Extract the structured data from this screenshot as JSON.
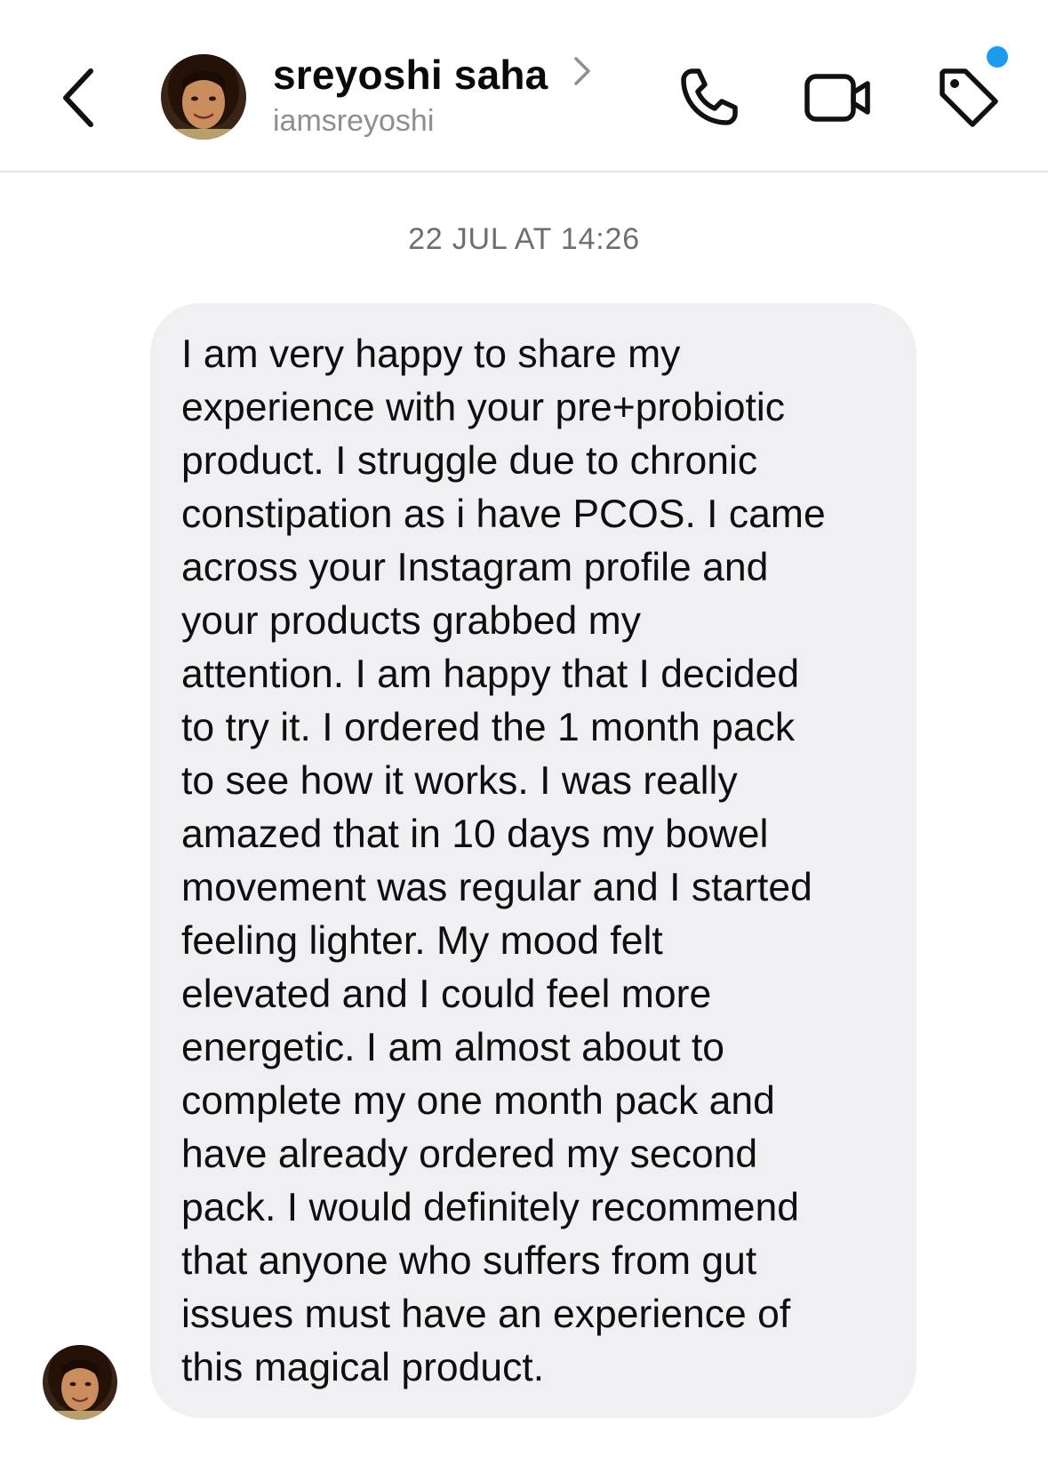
{
  "header": {
    "back_icon": "chevron-left-icon",
    "display_name": "sreyoshi saha",
    "username": "iamsreyoshi",
    "profile_chevron_icon": "chevron-right-icon",
    "actions": [
      {
        "name": "phone-icon"
      },
      {
        "name": "video-camera-icon"
      },
      {
        "name": "tag-icon"
      }
    ],
    "notification_dot_color": "#1d9bf0"
  },
  "conversation": {
    "timestamp": "22 JUL AT 14:26",
    "messages": [
      {
        "sender": "sreyoshi saha",
        "text": "I am very happy to share my\nexperience with your pre+probiotic\nproduct. I struggle due to chronic\nconstipation as i have PCOS. I came\nacross your Instagram profile and\nyour products grabbed my\nattention. I am happy that I decided\nto try it. I ordered the 1 month pack\nto see how it works. I was really\namazed that in 10 days my bowel\nmovement was regular and I started\nfeeling lighter. My mood felt\nelevated and I could feel more\nenergetic. I am almost about to\ncomplete my one month pack and\nhave already ordered my second\npack. I would definitely recommend\nthat anyone who suffers from gut\nissues must have an experience of\nthis magical product."
      }
    ]
  },
  "colors": {
    "bubble_background": "#f0f0f3",
    "timestamp_text": "#6e6e73",
    "username_text": "#8e8e93"
  }
}
